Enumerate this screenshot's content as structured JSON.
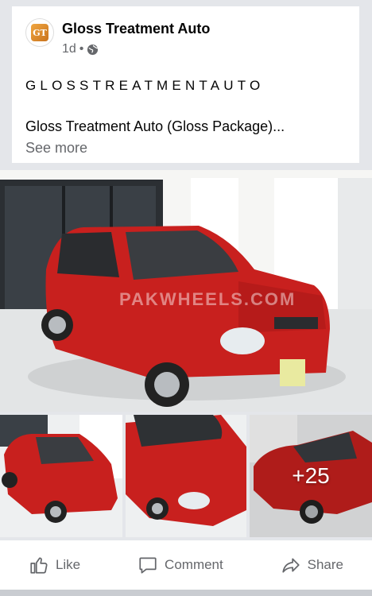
{
  "post": {
    "page_name": "Gloss Treatment Auto",
    "logo_text": "GT",
    "timestamp": "1d",
    "separator": "•",
    "privacy_icon": "globe-icon",
    "tagline": "GLOSSTREATMENTAUTO",
    "text": "Gloss Treatment Auto (Gloss Package)...",
    "see_more": "See more"
  },
  "photos": {
    "watermark": "PAKWHEELS.COM",
    "more_count": "+25"
  },
  "actions": {
    "like": "Like",
    "comment": "Comment",
    "share": "Share"
  },
  "colors": {
    "car_red": "#c8201e",
    "secondary_text": "#65676b"
  }
}
